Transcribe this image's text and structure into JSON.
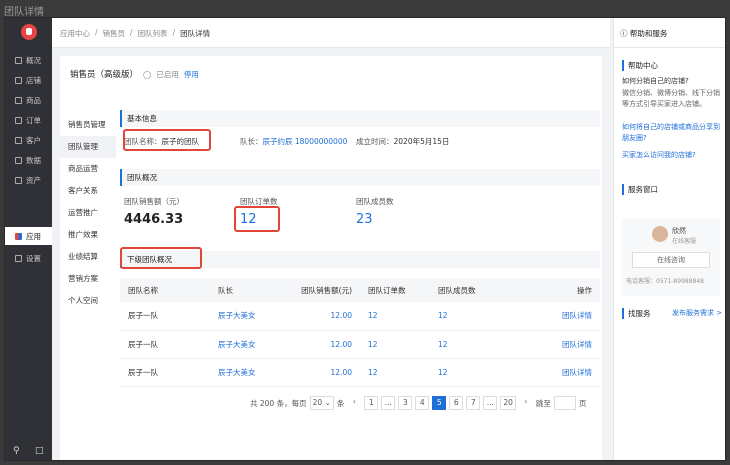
{
  "window": {
    "title": "团队详情"
  },
  "sidebar": {
    "items": [
      {
        "label": "概况"
      },
      {
        "label": "店铺"
      },
      {
        "label": "商品"
      },
      {
        "label": "订单"
      },
      {
        "label": "客户"
      },
      {
        "label": "数据"
      },
      {
        "label": "资产"
      },
      {
        "label": "应用"
      },
      {
        "label": "设置"
      }
    ]
  },
  "breadcrumb": [
    "应用中心",
    "销售员",
    "团队列表",
    "团队详情"
  ],
  "header": {
    "title": "销售员（高级版）",
    "status": "已启用",
    "action": "停用"
  },
  "subnav": [
    "销售员管理",
    "团队管理",
    "商品运营",
    "客户关系",
    "运营推广",
    "推广效果",
    "业绩结算",
    "营销方案",
    "个人空间"
  ],
  "basic": {
    "section": "基本信息",
    "name_label": "团队名称：",
    "name": "辰子的团队",
    "leader_label": "队长：",
    "leader": "辰子约辰 18000000000",
    "created_label": "成立时间：",
    "created": "2020年5月15日"
  },
  "overview": {
    "section": "团队概况",
    "sales_label": "团队销售额（元）",
    "sales": "4446.33",
    "orders_label": "团队订单数",
    "orders": "12",
    "members_label": "团队成员数",
    "members": "23"
  },
  "subteams": {
    "section": "下级团队概况",
    "columns": [
      "团队名称",
      "队长",
      "团队销售额(元)",
      "团队订单数",
      "团队成员数",
      "操作"
    ],
    "rows": [
      [
        "辰子一队",
        "辰子大美女",
        "12.00",
        "12",
        "12",
        "团队详情"
      ],
      [
        "辰子一队",
        "辰子大美女",
        "12.00",
        "12",
        "12",
        "团队详情"
      ],
      [
        "辰子一队",
        "辰子大美女",
        "12.00",
        "12",
        "12",
        "团队详情"
      ]
    ]
  },
  "pager": {
    "total": "共 200 条，每页",
    "size": "20",
    "unit": "条",
    "pages": [
      "1",
      "...",
      "3",
      "4",
      "5",
      "6",
      "7",
      "...",
      "20"
    ],
    "current": "5",
    "goto": "跳至",
    "page_unit": "页"
  },
  "help": {
    "title": "帮助和服务",
    "center": "帮助中心",
    "q1": "如何分销自己的店铺?",
    "a1": "微信分销、微博分销、线下分销等方式引导买家进入店铺。",
    "l1": "如何将自己的店铺或商品分享到朋友圈?",
    "l2": "买家怎么访问我的店铺?",
    "service": "服务窗口",
    "agent": "欣然",
    "agent_status": "在线客服",
    "consult": "在线咨询",
    "phone": "电话客服：0571-89988848",
    "find": "找服务",
    "publish": "发布服务需求 >"
  }
}
